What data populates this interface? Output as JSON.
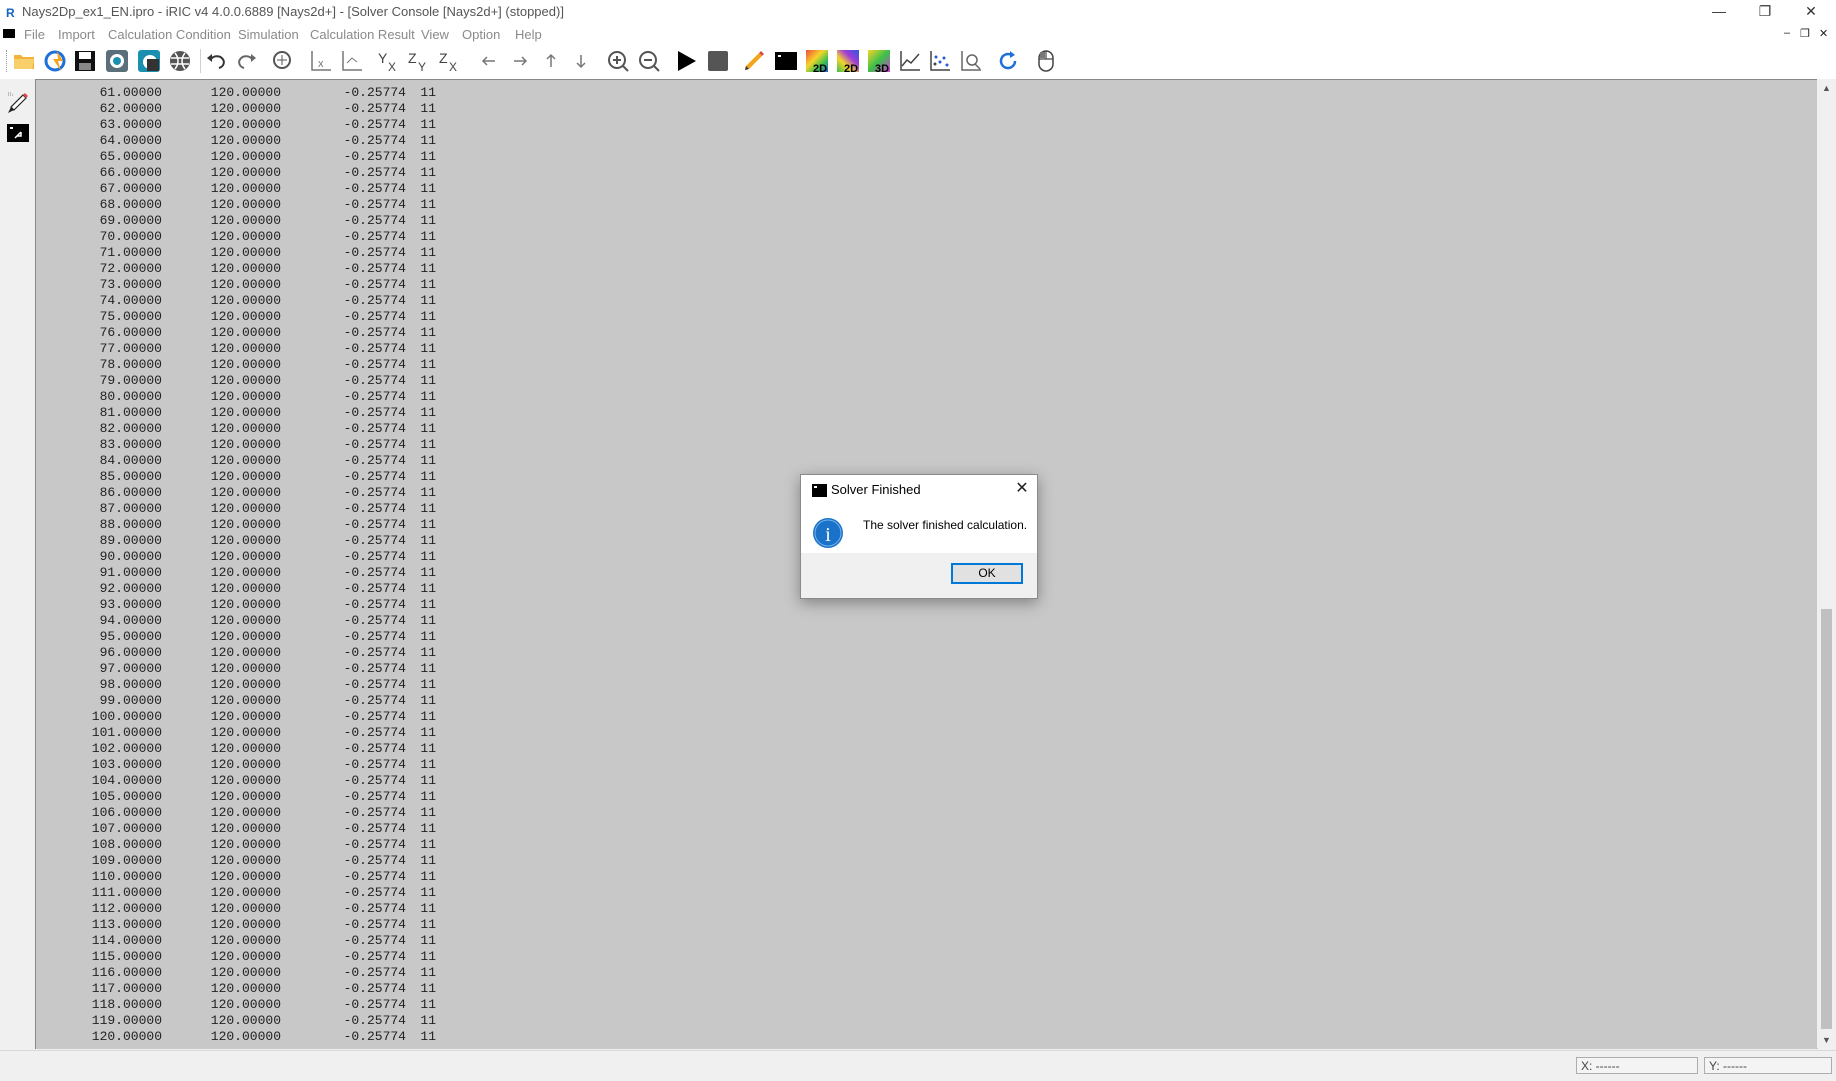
{
  "window": {
    "title": "Nays2Dp_ex1_EN.ipro - iRIC v4 4.0.0.6889 [Nays2d+] - [Solver Console [Nays2d+] (stopped)]",
    "minimize_glyph": "—",
    "restore_glyph": "❐",
    "close_glyph": "✕"
  },
  "menu": {
    "items": [
      "File",
      "Import",
      "Calculation Condition",
      "Simulation",
      "Calculation Result",
      "View",
      "Option",
      "Help"
    ],
    "mdi_minimize": "–",
    "mdi_restore": "❐",
    "mdi_close": "✕"
  },
  "toolbar_icons": [
    "open-folder-icon",
    "recent-icon",
    "save-icon",
    "snapshot-icon",
    "snapshot-window-icon",
    "grid-icon",
    "undo-icon",
    "redo-icon",
    "zoom-fit-icon",
    "axis-x-icon",
    "axis-ratio-icon",
    "axis-yx-icon",
    "axis-zy-icon",
    "axis-zx-icon",
    "arrow-left-icon",
    "arrow-right-icon",
    "arrow-up-icon",
    "arrow-down-icon",
    "zoom-in-icon",
    "zoom-out-icon",
    "run-icon",
    "stop-icon",
    "pencil-icon",
    "solver-console-icon",
    "contour-2d-icon",
    "contour-2d-alt-icon",
    "contour-3d-icon",
    "graph-icon",
    "scatter-graph-icon",
    "probe-icon",
    "refresh-icon",
    "mouse-icon"
  ],
  "console": {
    "rows": [
      [
        "61.00000",
        "120.00000",
        "-0.25774",
        "11"
      ],
      [
        "62.00000",
        "120.00000",
        "-0.25774",
        "11"
      ],
      [
        "63.00000",
        "120.00000",
        "-0.25774",
        "11"
      ],
      [
        "64.00000",
        "120.00000",
        "-0.25774",
        "11"
      ],
      [
        "65.00000",
        "120.00000",
        "-0.25774",
        "11"
      ],
      [
        "66.00000",
        "120.00000",
        "-0.25774",
        "11"
      ],
      [
        "67.00000",
        "120.00000",
        "-0.25774",
        "11"
      ],
      [
        "68.00000",
        "120.00000",
        "-0.25774",
        "11"
      ],
      [
        "69.00000",
        "120.00000",
        "-0.25774",
        "11"
      ],
      [
        "70.00000",
        "120.00000",
        "-0.25774",
        "11"
      ],
      [
        "71.00000",
        "120.00000",
        "-0.25774",
        "11"
      ],
      [
        "72.00000",
        "120.00000",
        "-0.25774",
        "11"
      ],
      [
        "73.00000",
        "120.00000",
        "-0.25774",
        "11"
      ],
      [
        "74.00000",
        "120.00000",
        "-0.25774",
        "11"
      ],
      [
        "75.00000",
        "120.00000",
        "-0.25774",
        "11"
      ],
      [
        "76.00000",
        "120.00000",
        "-0.25774",
        "11"
      ],
      [
        "77.00000",
        "120.00000",
        "-0.25774",
        "11"
      ],
      [
        "78.00000",
        "120.00000",
        "-0.25774",
        "11"
      ],
      [
        "79.00000",
        "120.00000",
        "-0.25774",
        "11"
      ],
      [
        "80.00000",
        "120.00000",
        "-0.25774",
        "11"
      ],
      [
        "81.00000",
        "120.00000",
        "-0.25774",
        "11"
      ],
      [
        "82.00000",
        "120.00000",
        "-0.25774",
        "11"
      ],
      [
        "83.00000",
        "120.00000",
        "-0.25774",
        "11"
      ],
      [
        "84.00000",
        "120.00000",
        "-0.25774",
        "11"
      ],
      [
        "85.00000",
        "120.00000",
        "-0.25774",
        "11"
      ],
      [
        "86.00000",
        "120.00000",
        "-0.25774",
        "11"
      ],
      [
        "87.00000",
        "120.00000",
        "-0.25774",
        "11"
      ],
      [
        "88.00000",
        "120.00000",
        "-0.25774",
        "11"
      ],
      [
        "89.00000",
        "120.00000",
        "-0.25774",
        "11"
      ],
      [
        "90.00000",
        "120.00000",
        "-0.25774",
        "11"
      ],
      [
        "91.00000",
        "120.00000",
        "-0.25774",
        "11"
      ],
      [
        "92.00000",
        "120.00000",
        "-0.25774",
        "11"
      ],
      [
        "93.00000",
        "120.00000",
        "-0.25774",
        "11"
      ],
      [
        "94.00000",
        "120.00000",
        "-0.25774",
        "11"
      ],
      [
        "95.00000",
        "120.00000",
        "-0.25774",
        "11"
      ],
      [
        "96.00000",
        "120.00000",
        "-0.25774",
        "11"
      ],
      [
        "97.00000",
        "120.00000",
        "-0.25774",
        "11"
      ],
      [
        "98.00000",
        "120.00000",
        "-0.25774",
        "11"
      ],
      [
        "99.00000",
        "120.00000",
        "-0.25774",
        "11"
      ],
      [
        "100.00000",
        "120.00000",
        "-0.25774",
        "11"
      ],
      [
        "101.00000",
        "120.00000",
        "-0.25774",
        "11"
      ],
      [
        "102.00000",
        "120.00000",
        "-0.25774",
        "11"
      ],
      [
        "103.00000",
        "120.00000",
        "-0.25774",
        "11"
      ],
      [
        "104.00000",
        "120.00000",
        "-0.25774",
        "11"
      ],
      [
        "105.00000",
        "120.00000",
        "-0.25774",
        "11"
      ],
      [
        "106.00000",
        "120.00000",
        "-0.25774",
        "11"
      ],
      [
        "107.00000",
        "120.00000",
        "-0.25774",
        "11"
      ],
      [
        "108.00000",
        "120.00000",
        "-0.25774",
        "11"
      ],
      [
        "109.00000",
        "120.00000",
        "-0.25774",
        "11"
      ],
      [
        "110.00000",
        "120.00000",
        "-0.25774",
        "11"
      ],
      [
        "111.00000",
        "120.00000",
        "-0.25774",
        "11"
      ],
      [
        "112.00000",
        "120.00000",
        "-0.25774",
        "11"
      ],
      [
        "113.00000",
        "120.00000",
        "-0.25774",
        "11"
      ],
      [
        "114.00000",
        "120.00000",
        "-0.25774",
        "11"
      ],
      [
        "115.00000",
        "120.00000",
        "-0.25774",
        "11"
      ],
      [
        "116.00000",
        "120.00000",
        "-0.25774",
        "11"
      ],
      [
        "117.00000",
        "120.00000",
        "-0.25774",
        "11"
      ],
      [
        "118.00000",
        "120.00000",
        "-0.25774",
        "11"
      ],
      [
        "119.00000",
        "120.00000",
        "-0.25774",
        "11"
      ],
      [
        "120.00000",
        "120.00000",
        "-0.25774",
        "11"
      ]
    ]
  },
  "scrollbar": {
    "up_glyph": "▲",
    "down_glyph": "▼"
  },
  "status": {
    "x_label": "X: ------",
    "y_label": "Y: ------"
  },
  "dialog": {
    "title": "Solver Finished",
    "message": "The solver finished calculation.",
    "ok_label": "OK",
    "close_glyph": "✕",
    "info_glyph": "i"
  },
  "colors": {
    "console_bg": "#c8c8c8",
    "accent": "#0078d7",
    "info_icon": "#1a73c8"
  }
}
